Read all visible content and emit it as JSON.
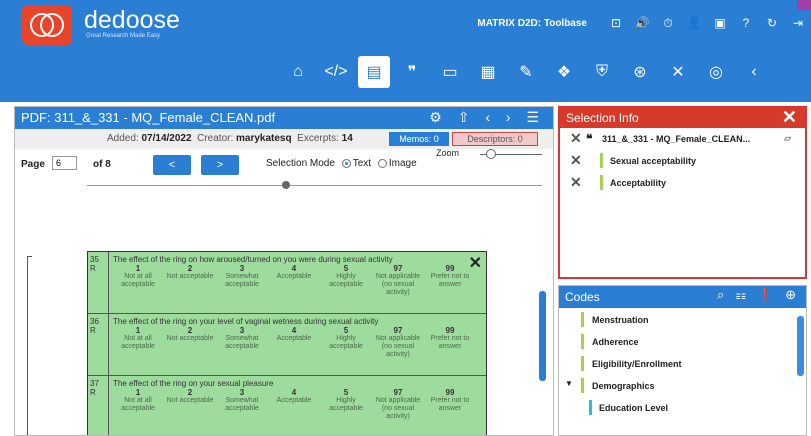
{
  "header": {
    "brand": "dedoose",
    "tagline": "Great Research Made Easy",
    "db_name": "MATRIX D2D: Toolbase"
  },
  "doc": {
    "title": "PDF: 311_&_331 - MQ_Female_CLEAN.pdf",
    "added_label": "Added:",
    "added": "07/14/2022",
    "creator_label": "Creator:",
    "creator": "marykatesq",
    "excerpts_label": "Excerpts:",
    "excerpts": "14",
    "memos": "Memos: 0",
    "descriptors": "Descriptors: 0",
    "page_label": "Page",
    "page_value": "6",
    "of_label": "of 8",
    "prev": "<",
    "next": ">",
    "selection_mode": "Selection Mode",
    "text": "Text",
    "image": "Image",
    "zoom": "Zoom",
    "rows": [
      {
        "id": "35 R",
        "q": "The effect of the ring on how aroused/turned on you were during sexual activity"
      },
      {
        "id": "36 R",
        "q": "The effect of the ring on your level of vaginal wetness during sexual activity"
      },
      {
        "id": "37 R",
        "q": "The effect of the ring on your sexual pleasure"
      }
    ],
    "scale": [
      {
        "n": "1",
        "t": "Not at all acceptable"
      },
      {
        "n": "2",
        "t": "Not acceptable"
      },
      {
        "n": "3",
        "t": "Somewhat acceptable"
      },
      {
        "n": "4",
        "t": "Acceptable"
      },
      {
        "n": "5",
        "t": "Highly acceptable"
      },
      {
        "n": "97",
        "t": "Not applicable (no sexual activity)"
      },
      {
        "n": "99",
        "t": "Prefer not to answer"
      }
    ]
  },
  "selection": {
    "title": "Selection Info",
    "doc": "311_&_331 - MQ_Female_CLEAN...",
    "codes": [
      "Sexual acceptability",
      "Acceptability"
    ]
  },
  "codes": {
    "title": "Codes",
    "items": [
      "Menstruation",
      "Adherence",
      "Eligibility/Enrollment",
      "Demographics"
    ],
    "sub": [
      "Education Level"
    ]
  }
}
